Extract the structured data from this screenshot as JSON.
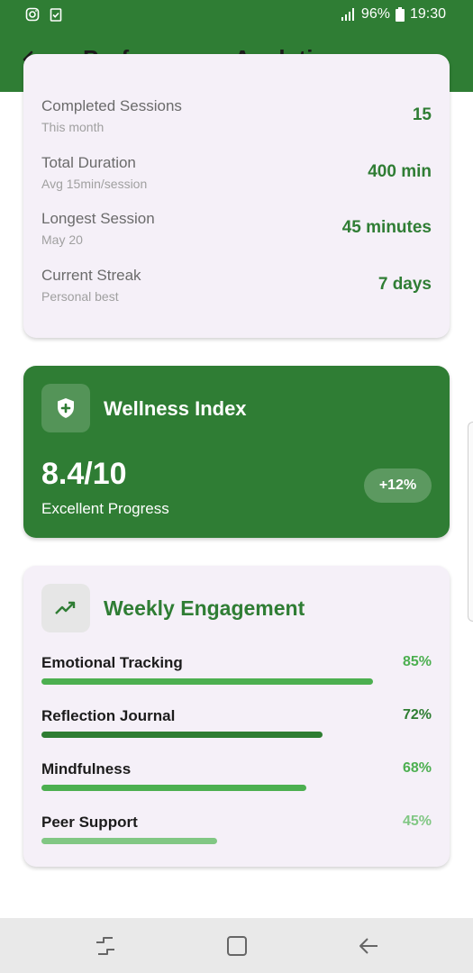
{
  "status_bar": {
    "battery": "96%",
    "time": "19:30",
    "icons": [
      "instagram-icon",
      "clipboard-check-icon",
      "signal-icon",
      "battery-icon"
    ]
  },
  "app_bar": {
    "title": "Performance Analytics",
    "back_icon": "arrow-left-icon"
  },
  "stats": [
    {
      "label": "Completed Sessions",
      "sub": "This month",
      "value": "15"
    },
    {
      "label": "Total Duration",
      "sub": "Avg 15min/session",
      "value": "400 min"
    },
    {
      "label": "Longest Session",
      "sub": "May 20",
      "value": "45 minutes"
    },
    {
      "label": "Current Streak",
      "sub": "Personal best",
      "value": "7 days"
    }
  ],
  "wellness": {
    "icon": "shield-plus-icon",
    "title": "Wellness Index",
    "score": "8.4/10",
    "subtitle": "Excellent Progress",
    "change": "+12%"
  },
  "engagement": {
    "icon": "trending-up-icon",
    "title": "Weekly Engagement",
    "items": [
      {
        "label": "Emotional Tracking",
        "percent_text": "85%",
        "fraction": 0.85,
        "color": "#4caf50"
      },
      {
        "label": "Reflection Journal",
        "percent_text": "72%",
        "fraction": 0.72,
        "color": "#2e7d32"
      },
      {
        "label": "Mindfulness",
        "percent_text": "68%",
        "fraction": 0.68,
        "color": "#4caf50"
      },
      {
        "label": "Peer Support",
        "percent_text": "45%",
        "fraction": 0.45,
        "color": "#81c784"
      }
    ]
  },
  "colors": {
    "primary": "#2f7d34",
    "card_background": "#f5f0f8"
  },
  "nav_bar": {
    "icons": [
      "recent-apps-icon",
      "home-icon",
      "back-icon"
    ]
  }
}
